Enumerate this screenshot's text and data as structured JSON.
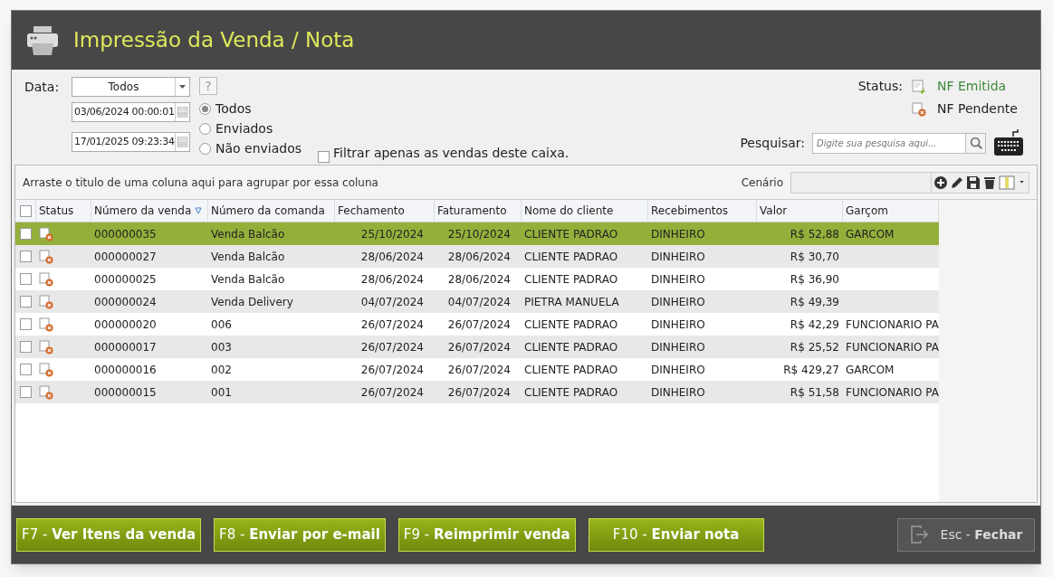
{
  "window": {
    "title": "Impressão da Venda / Nota"
  },
  "filters": {
    "date_label": "Data:",
    "date_mode": "Todos",
    "help": "?",
    "date_from": "03/06/2024 00:00:01",
    "date_to": "17/01/2025 09:23:34",
    "radios": [
      {
        "label": "Todos",
        "selected": true
      },
      {
        "label": "Enviados",
        "selected": false
      },
      {
        "label": "Não enviados",
        "selected": false
      }
    ],
    "only_this_register": {
      "label": "Filtrar apenas as vendas deste caixa.",
      "checked": false
    }
  },
  "status_legend": {
    "label": "Status:",
    "items": [
      {
        "kind": "emitida",
        "label": "NF Emitida"
      },
      {
        "kind": "pendente",
        "label": "NF Pendente"
      }
    ]
  },
  "search": {
    "label": "Pesquisar:",
    "placeholder": "Digite sua pesquisa aqui..."
  },
  "grid": {
    "group_hint": "Arraste o titulo de uma coluna aqui para agrupar por essa coluna",
    "scenario_label": "Cenário",
    "all_checked": false,
    "columns": [
      {
        "label": "Status",
        "sorted": false
      },
      {
        "label": "Número da venda",
        "sorted": true
      },
      {
        "label": "Número da comanda",
        "sorted": false
      },
      {
        "label": "Fechamento",
        "sorted": false
      },
      {
        "label": "Faturamento",
        "sorted": false
      },
      {
        "label": "Nome do cliente",
        "sorted": false
      },
      {
        "label": "Recebimentos",
        "sorted": false
      },
      {
        "label": "Valor",
        "sorted": false
      },
      {
        "label": "Garçom",
        "sorted": false
      }
    ],
    "rows": [
      {
        "selected": true,
        "checked": false,
        "kind": "pendente",
        "cells": [
          "",
          "000000035",
          "Venda Balcão",
          "25/10/2024",
          "25/10/2024",
          "CLIENTE PADRAO",
          "DINHEIRO",
          "R$ 52,88",
          "GARCOM"
        ]
      },
      {
        "selected": false,
        "checked": false,
        "kind": "pendente",
        "cells": [
          "",
          "000000027",
          "Venda Balcão",
          "28/06/2024",
          "28/06/2024",
          "CLIENTE PADRAO",
          "DINHEIRO",
          "R$ 30,70",
          ""
        ]
      },
      {
        "selected": false,
        "checked": false,
        "kind": "pendente",
        "cells": [
          "",
          "000000025",
          "Venda Balcão",
          "28/06/2024",
          "28/06/2024",
          "CLIENTE PADRAO",
          "DINHEIRO",
          "R$ 36,90",
          ""
        ]
      },
      {
        "selected": false,
        "checked": false,
        "kind": "pendente",
        "cells": [
          "",
          "000000024",
          "Venda Delivery",
          "04/07/2024",
          "04/07/2024",
          "PIETRA MANUELA",
          "DINHEIRO",
          "R$ 49,39",
          ""
        ]
      },
      {
        "selected": false,
        "checked": false,
        "kind": "pendente",
        "cells": [
          "",
          "000000020",
          "006",
          "26/07/2024",
          "26/07/2024",
          "CLIENTE PADRAO",
          "DINHEIRO",
          "R$ 42,29",
          "FUNCIONARIO PA"
        ]
      },
      {
        "selected": false,
        "checked": false,
        "kind": "pendente",
        "cells": [
          "",
          "000000017",
          "003",
          "26/07/2024",
          "26/07/2024",
          "CLIENTE PADRAO",
          "DINHEIRO",
          "R$ 25,52",
          "FUNCIONARIO PA"
        ]
      },
      {
        "selected": false,
        "checked": false,
        "kind": "pendente",
        "cells": [
          "",
          "000000016",
          "002",
          "26/07/2024",
          "26/07/2024",
          "CLIENTE PADRAO",
          "DINHEIRO",
          "R$ 429,27",
          "GARCOM"
        ]
      },
      {
        "selected": false,
        "checked": false,
        "kind": "pendente",
        "cells": [
          "",
          "000000015",
          "001",
          "26/07/2024",
          "26/07/2024",
          "CLIENTE PADRAO",
          "DINHEIRO",
          "R$ 51,58",
          "FUNCIONARIO PA"
        ]
      }
    ]
  },
  "actions": [
    {
      "label": "F7 - **Ver Itens da venda**"
    },
    {
      "label": "F8 - **Enviar por e-mail**"
    },
    {
      "label": "F9 - **Reimprimir venda**"
    },
    {
      "label": "F10 - **Enviar nota**"
    }
  ],
  "close_button": {
    "label": "Esc - **Fechar**"
  }
}
